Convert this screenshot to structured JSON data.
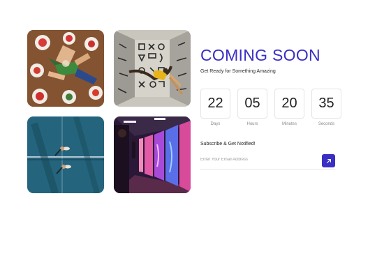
{
  "hero": {
    "title": "COMING SOON",
    "subtitle": "Get Ready for Something Amazing"
  },
  "countdown": [
    {
      "value": "22",
      "label": "Days"
    },
    {
      "value": "05",
      "label": "Hours"
    },
    {
      "value": "20",
      "label": "Minutes"
    },
    {
      "value": "35",
      "label": "Seconds"
    }
  ],
  "subscribe": {
    "heading": "Subscribe & Get Notified!",
    "placeholder": "Enter Your Email Address",
    "submit_icon": "arrow-up-right-icon"
  },
  "gallery": [
    {
      "icon": "dinner-party-photo"
    },
    {
      "icon": "graffiti-wall-photo"
    },
    {
      "icon": "tennis-court-aerial-photo"
    },
    {
      "icon": "neon-gallery-corridor-photo"
    }
  ],
  "colors": {
    "accent": "#3a2fc4",
    "border": "#e4e4ea",
    "background": "#ffffff"
  }
}
